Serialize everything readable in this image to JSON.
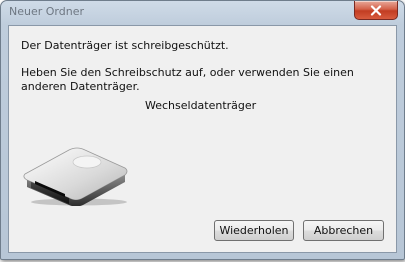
{
  "dialog": {
    "title": "Neuer Ordner",
    "message_line1": "Der Datenträger ist schreibgeschützt.",
    "message_line2": "Heben Sie den Schreibschutz auf, oder verwenden Sie einen anderen Datenträger.",
    "device_name": "Wechseldatenträger",
    "icon": "removable-drive-icon",
    "close_icon": "close-icon"
  },
  "buttons": {
    "retry_label": "Wiederholen",
    "cancel_label": "Abbrechen"
  },
  "colors": {
    "titlebar": "#bfcddc",
    "close_button": "#c23d22",
    "client_background": "#f0f0f0"
  }
}
